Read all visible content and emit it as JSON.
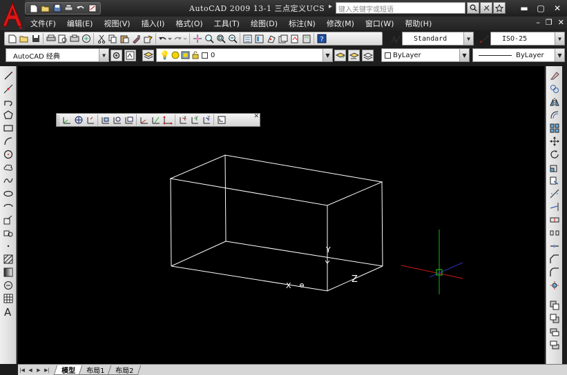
{
  "window": {
    "title": "AutoCAD 2009  13-1 三点定义UCS",
    "search_placeholder": "键入关键字或短语"
  },
  "menu": {
    "items": [
      "文件(F)",
      "编辑(E)",
      "视图(V)",
      "插入(I)",
      "格式(O)",
      "工具(T)",
      "绘图(D)",
      "标注(N)",
      "修改(M)",
      "窗口(W)",
      "帮助(H)"
    ]
  },
  "toolbars": {
    "text_style": "Standard",
    "dim_style": "ISO-25",
    "workspace": "AutoCAD 经典",
    "layer": "0",
    "color": "ByLayer",
    "linetype": "ByLayer"
  },
  "canvas": {
    "axis_labels": {
      "x": "X",
      "y": "Y",
      "z": "Z"
    }
  },
  "tabs": [
    "模型",
    "布局1",
    "布局2"
  ],
  "colors": {
    "background": "#000000",
    "wireframe": "#ffffff",
    "cursor_x": "#ff2020",
    "cursor_y": "#00c000"
  }
}
